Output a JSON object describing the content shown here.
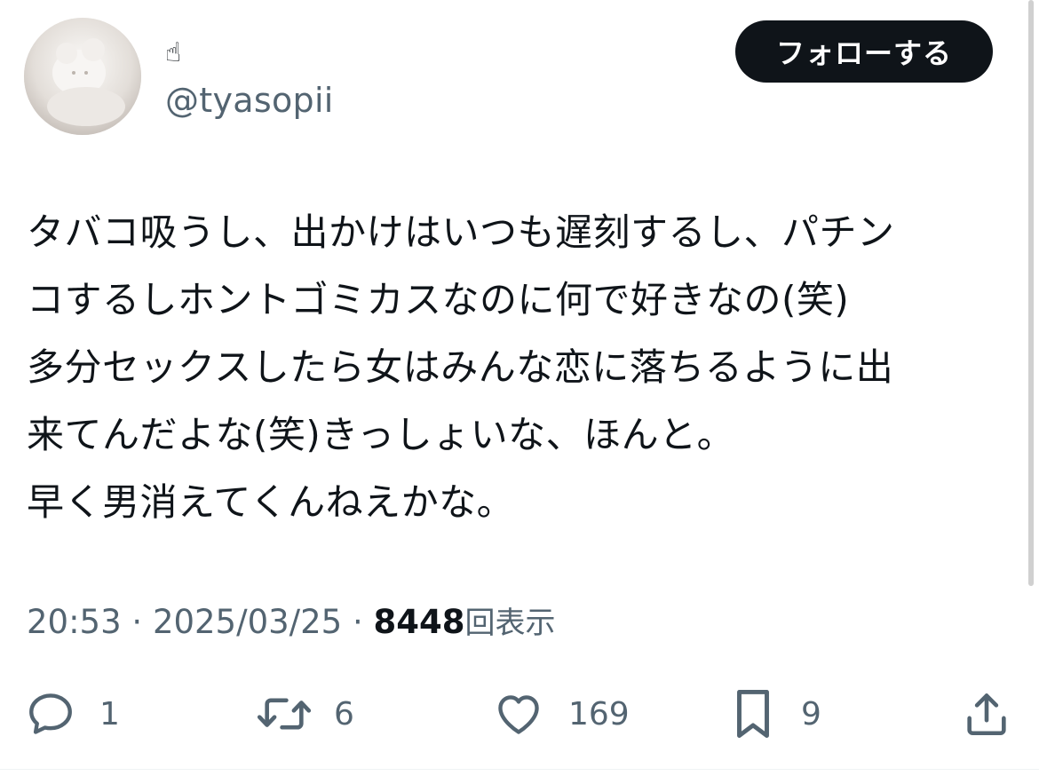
{
  "user": {
    "display_name": "☝",
    "handle": "@tyasopii",
    "avatar_icon": "avatar-image"
  },
  "follow_button_label": "フォローする",
  "tweet": {
    "text": "タバコ吸うし、出かけはいつも遅刻するし、パチン\nコするしホントゴミカスなのに何で好きなの(笑)\n多分セックスしたら女はみんな恋に落ちるように出\n来てんだよな(笑)きっしょいな、ほんと。\n早く男消えてくんねえかな。"
  },
  "meta": {
    "time": "20:53",
    "separator": " · ",
    "date": "2025/03/25",
    "views_count": "8448",
    "views_label": "回表示"
  },
  "actions": {
    "reply": {
      "icon": "reply-icon",
      "count": "1"
    },
    "retweet": {
      "icon": "retweet-icon",
      "count": "6"
    },
    "like": {
      "icon": "heart-icon",
      "count": "169"
    },
    "bookmark": {
      "icon": "bookmark-icon",
      "count": "9"
    },
    "share": {
      "icon": "share-icon"
    }
  },
  "colors": {
    "text_primary": "#0f1419",
    "text_secondary": "#536471",
    "button_bg": "#0f1419",
    "button_text": "#ffffff"
  }
}
